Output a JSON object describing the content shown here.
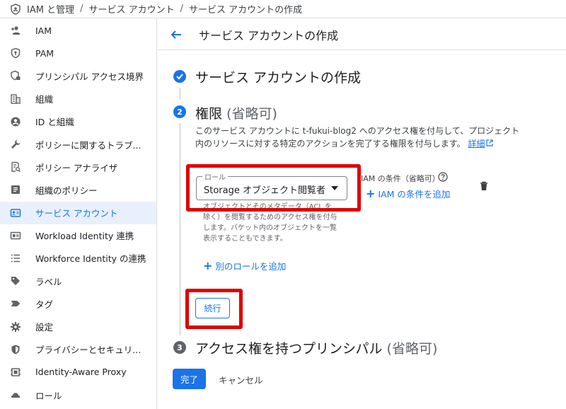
{
  "breadcrumb": {
    "items": [
      "IAM と管理",
      "サービス アカウント",
      "サービス アカウントの作成"
    ],
    "separator": "/"
  },
  "sidebar": {
    "items": [
      {
        "label": "IAM",
        "icon": "person-add-icon"
      },
      {
        "label": "PAM",
        "icon": "shield-key-icon"
      },
      {
        "label": "プリンシパル アクセス境界",
        "icon": "shield-lock-icon"
      },
      {
        "label": "組織",
        "icon": "domain-icon"
      },
      {
        "label": "ID と組織",
        "icon": "account-circle-icon"
      },
      {
        "label": "ポリシーに関するトラブ...",
        "icon": "wrench-icon"
      },
      {
        "label": "ポリシー アナライザ",
        "icon": "policy-analyzer-icon"
      },
      {
        "label": "組織のポリシー",
        "icon": "list-alt-icon"
      },
      {
        "label": "サービス アカウント",
        "icon": "service-account-icon",
        "active": true
      },
      {
        "label": "Workload Identity 連携",
        "icon": "id-card-icon"
      },
      {
        "label": "Workforce Identity の連携",
        "icon": "list-icon"
      },
      {
        "label": "ラベル",
        "icon": "label-icon"
      },
      {
        "label": "タグ",
        "icon": "tag-icon"
      },
      {
        "label": "設定",
        "icon": "gear-icon"
      },
      {
        "label": "プライバシーとセキュリ...",
        "icon": "shield-icon"
      },
      {
        "label": "Identity-Aware Proxy",
        "icon": "proxy-icon"
      },
      {
        "label": "ロール",
        "icon": "role-hat-icon"
      }
    ]
  },
  "header": {
    "title": "サービス アカウントの作成"
  },
  "steps": {
    "step1": {
      "title": "サービス アカウントの作成"
    },
    "step2": {
      "number": "2",
      "title": "権限",
      "optional": "(省略可)",
      "description": "このサービス アカウントに t-fukui-blog2 へのアクセス権を付与して、プロジェクト内のリソースに対する特定のアクションを完了する権限を付与します。",
      "more_link": "詳細",
      "role_field_label": "ロール",
      "role_value": "Storage オブジェクト閲覧者",
      "role_description": "オブジェクトとそのメタデータ（ACL を除く）を閲覧するためのアクセス権を付与します。バケット内のオブジェクトを一覧表示することもできます。",
      "iam_condition_label": "IAM の条件（省略可）",
      "iam_condition_add": "IAM の条件を追加",
      "add_role": "別のロールを追加",
      "continue": "続行"
    },
    "step3": {
      "number": "3",
      "title": "アクセス権を持つプリンシパル",
      "optional": "(省略可)"
    }
  },
  "actions": {
    "done": "完了",
    "cancel": "キャンセル"
  },
  "colors": {
    "accent": "#1a73e8",
    "highlight": "#e00000",
    "active_bg": "#e8f0fe"
  }
}
